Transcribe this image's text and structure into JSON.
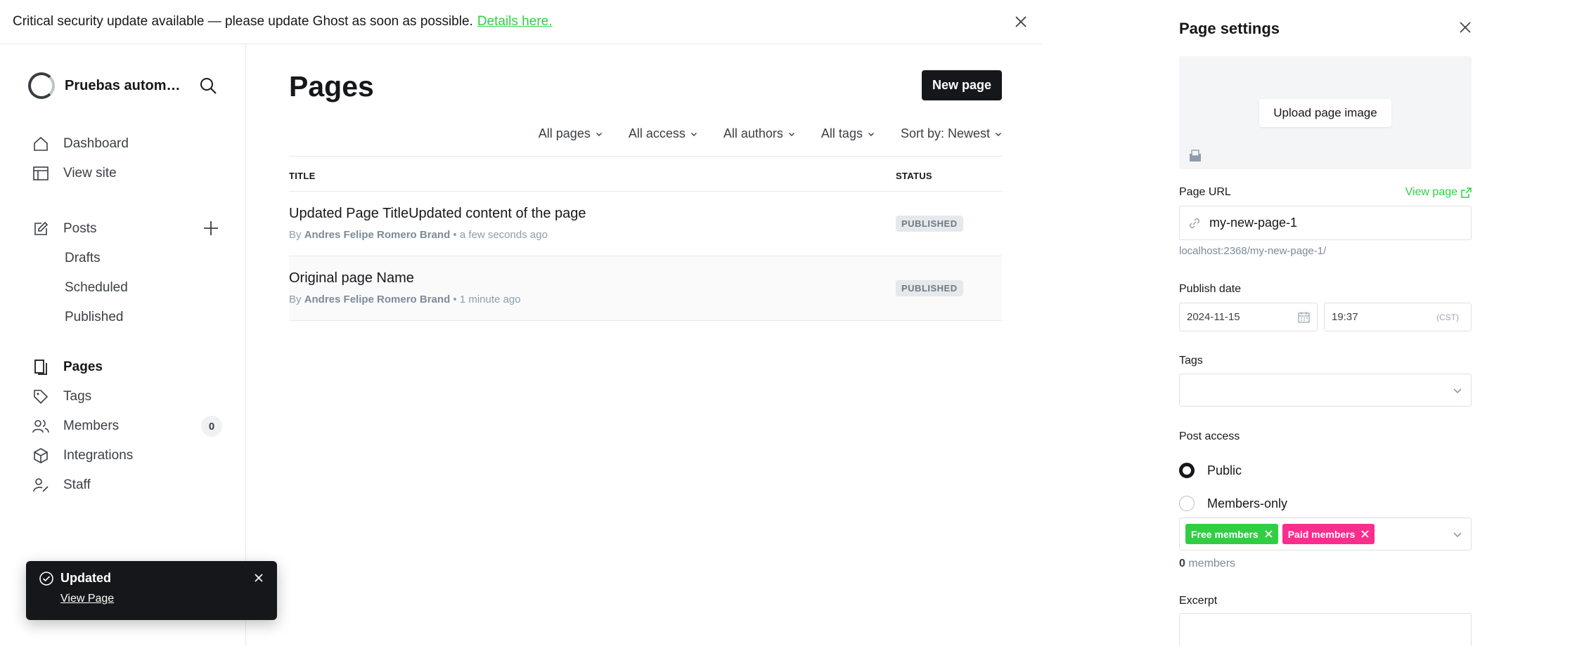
{
  "banner": {
    "message": "Critical security update available — please update Ghost as soon as possible.",
    "link_text": "Details here."
  },
  "sidebar": {
    "site_name": "Pruebas automa...",
    "items": [
      {
        "label": "Dashboard"
      },
      {
        "label": "View site"
      },
      {
        "label": "Posts"
      },
      {
        "label": "Drafts"
      },
      {
        "label": "Scheduled"
      },
      {
        "label": "Published"
      },
      {
        "label": "Pages"
      },
      {
        "label": "Tags"
      },
      {
        "label": "Members",
        "count": "0"
      },
      {
        "label": "Integrations"
      },
      {
        "label": "Staff"
      }
    ]
  },
  "toast": {
    "title": "Updated",
    "link": "View Page"
  },
  "main": {
    "title": "Pages",
    "new_button": "New page",
    "filters": [
      "All pages",
      "All access",
      "All authors",
      "All tags",
      "Sort by: Newest"
    ],
    "columns": {
      "title": "TITLE",
      "status": "STATUS"
    },
    "rows": [
      {
        "title": "Updated Page TitleUpdated content of the page",
        "by": "By",
        "author": "Andres Felipe Romero Brand",
        "time": "• a few seconds ago",
        "status": "PUBLISHED"
      },
      {
        "title": "Original page Name",
        "by": "By",
        "author": "Andres Felipe Romero Brand",
        "time": "• 1 minute ago",
        "status": "PUBLISHED"
      }
    ]
  },
  "settings": {
    "title": "Page settings",
    "upload_label": "Upload page image",
    "url_label": "Page URL",
    "view_page": "View page",
    "url_value": "my-new-page-1",
    "url_hint": "localhost:2368/my-new-page-1/",
    "publish_label": "Publish date",
    "date": "2024-11-15",
    "time": "19:37",
    "timezone": "(CST)",
    "tags_label": "Tags",
    "access_label": "Post access",
    "access_options": [
      "Public",
      "Members-only"
    ],
    "tiers": [
      "Free members",
      "Paid members"
    ],
    "members_count": "0",
    "members_suffix": " members",
    "excerpt_label": "Excerpt",
    "colors": {
      "accent": "#30cf43",
      "paid": "#fb2d8d",
      "dark": "#15171a"
    }
  }
}
